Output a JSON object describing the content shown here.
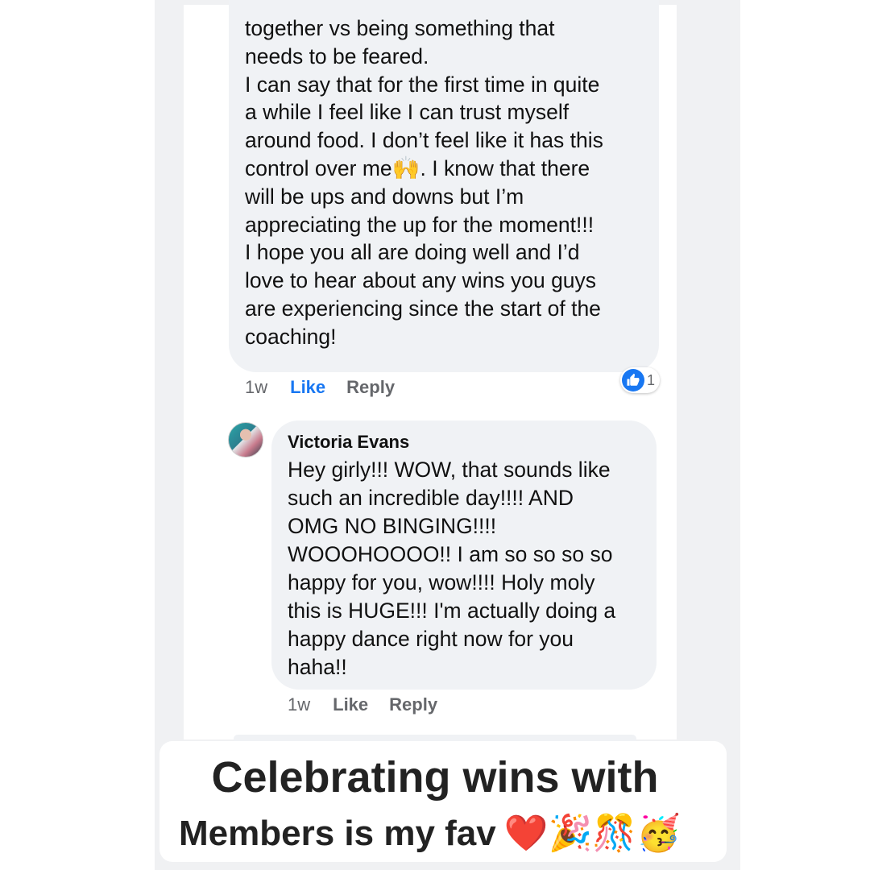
{
  "comment_main": {
    "text": "together vs being something that\nneeds to be feared.\nI can say that for the first time in quite\na while I feel like I can trust myself\naround food. I don’t feel like it has this\ncontrol over me",
    "emoji": "🙌",
    "text_after": ". I know that there\nwill be ups and downs but I’m\nappreciating the up for the moment!!!\nI hope you all are doing well and I’d\nlove to hear about any wins you guys\nare experiencing since the start of the\ncoaching!",
    "time": "1w",
    "like_label": "Like",
    "reply_label": "Reply",
    "reaction_count": "1"
  },
  "reply_comment": {
    "author": "Victoria Evans",
    "text": "Hey girly!!! WOW, that sounds like\nsuch an incredible day!!!! AND\nOMG NO BINGING!!!!\nWOOOHOOOO!! I am so so so so\nhappy for you, wow!!!! Holy moly\nthis is HUGE!!! I'm actually doing a\nhappy dance right now for you\nhaha!!",
    "time": "1w",
    "like_label": "Like",
    "reply_label": "Reply"
  },
  "caption": {
    "line1": "Celebrating wins with",
    "line2": "Members is my fav",
    "emojis": "❤️🎉🎊🥳"
  },
  "colors": {
    "facebook_blue": "#1877f2",
    "bubble_gray": "#f0f2f5",
    "meta_gray": "#65676b"
  }
}
